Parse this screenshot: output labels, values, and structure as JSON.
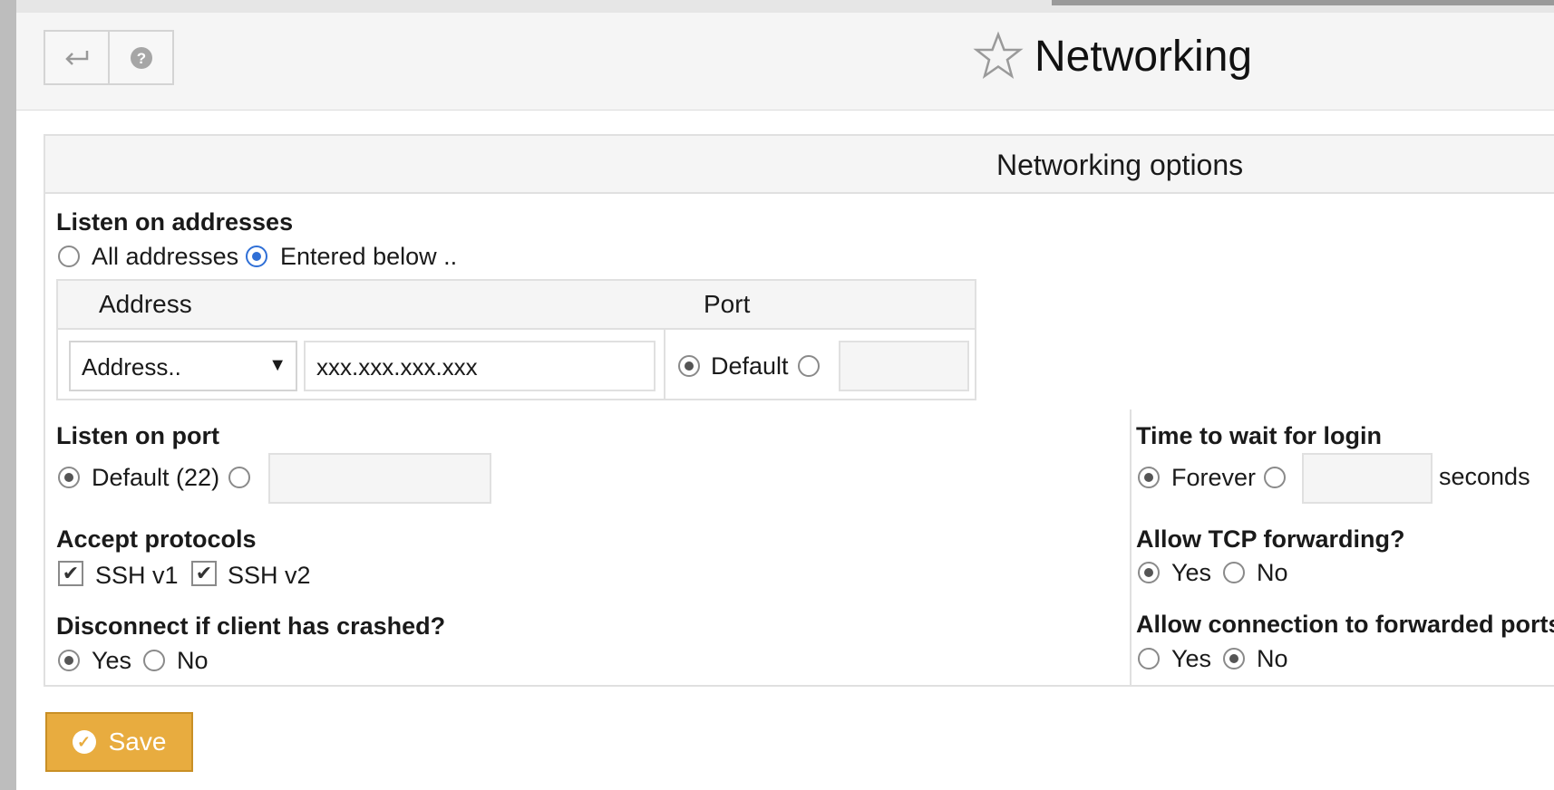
{
  "header": {
    "title": "Networking",
    "back_icon": "back-arrow-icon",
    "help_icon": "help-icon",
    "star_icon": "star-icon"
  },
  "panel": {
    "title": "Networking options"
  },
  "listen_addresses": {
    "label": "Listen on addresses",
    "options": [
      "All addresses",
      "Entered below .."
    ],
    "selected": "Entered below ..",
    "table": {
      "col_address": "Address",
      "col_port": "Port",
      "row": {
        "address_select": "Address..",
        "address_value": "xxx.xxx.xxx.xxx",
        "port_default": "Default",
        "port_selected": "Default",
        "port_value": ""
      }
    }
  },
  "listen_port": {
    "label": "Listen on port",
    "default_label": "Default (22)",
    "selected": "Default (22)",
    "value": ""
  },
  "protocols": {
    "label": "Accept protocols",
    "v1": "SSH v1",
    "v2": "SSH v2",
    "v1_checked": true,
    "v2_checked": true
  },
  "disconnect": {
    "label": "Disconnect if client has crashed?",
    "yes": "Yes",
    "no": "No",
    "selected": "Yes"
  },
  "login_wait": {
    "label": "Time to wait for login",
    "forever": "Forever",
    "selected": "Forever",
    "value": "",
    "unit": "seconds"
  },
  "tcp_forwarding": {
    "label": "Allow TCP forwarding?",
    "yes": "Yes",
    "no": "No",
    "selected": "Yes"
  },
  "forwarded_ports": {
    "label": "Allow connection to forwarded ports?",
    "yes": "Yes",
    "no": "No",
    "selected": "No"
  },
  "save": {
    "label": "Save",
    "icon": "check-circle-icon"
  },
  "colors": {
    "save_bg": "#e8ac3f",
    "radio_selected_blue": "#2f6fd6"
  }
}
